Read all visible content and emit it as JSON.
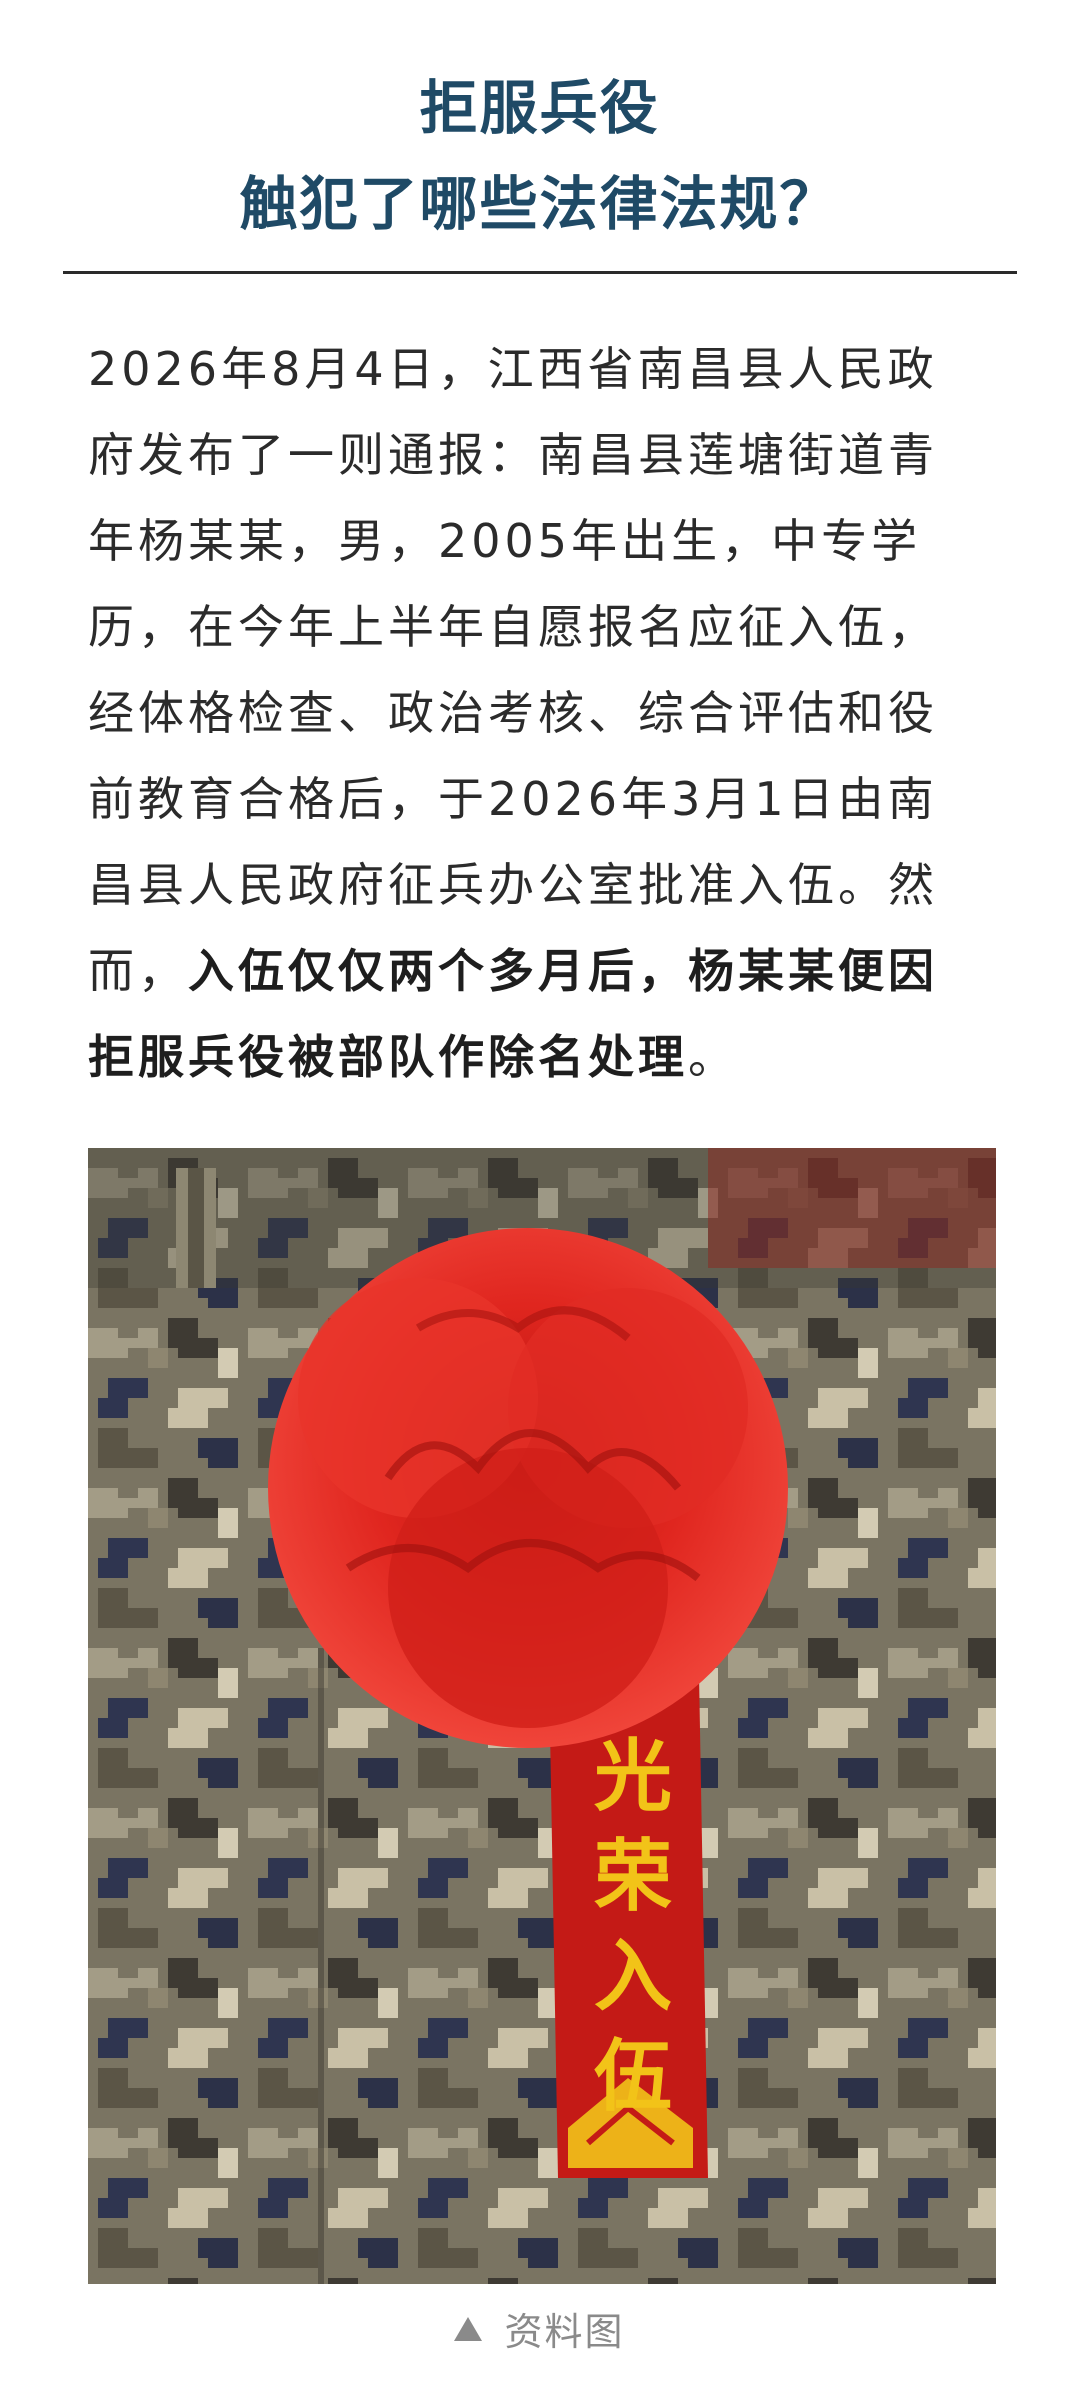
{
  "article": {
    "title_line1": "拒服兵役",
    "title_line2": "触犯了哪些法律法规？",
    "paragraph_lines": [
      "2026年8月4日，江西省南昌县人民政",
      "府发布了一则通报：南昌县莲塘街道青",
      "年杨某某，男，2005年出生，中专学",
      "历，在今年上半年自愿报名应征入伍，",
      "经体格检查、政治考核、综合评估和役",
      "前教育合格后，于2026年3月1日由南",
      "昌县人民政府征兵办公室批准入伍。然"
    ],
    "line8_plain": "而，",
    "line8_bold": "入伍仅仅两个多月后，杨某某便因",
    "line9_bold": "拒服兵役被部队作除名处理",
    "line9_end": "。"
  },
  "photo": {
    "ribbon_text": [
      "光",
      "荣",
      "入",
      "伍"
    ]
  },
  "caption": {
    "text": "资料图"
  },
  "colors": {
    "title": "#1f4a66",
    "body": "#2b2b2b",
    "flower_red": "#e0261f",
    "ribbon_gold": "#f2c318"
  }
}
